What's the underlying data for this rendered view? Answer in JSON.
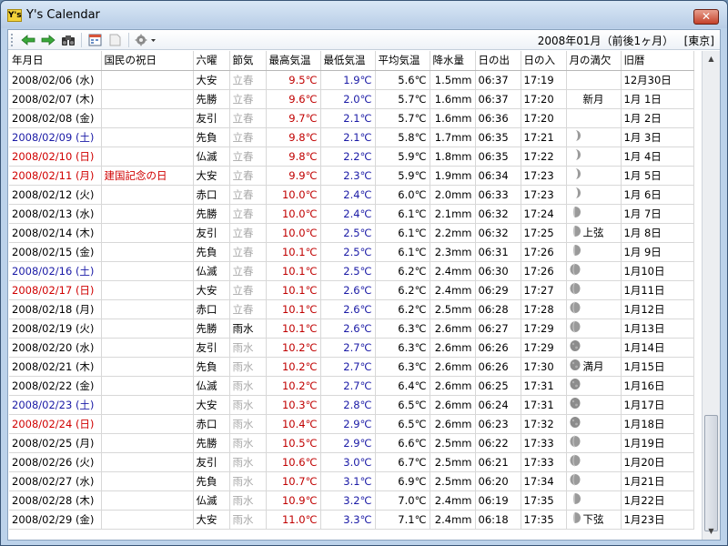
{
  "window": {
    "title": "Y's Calendar",
    "app_icon": "Y's",
    "close": "✕"
  },
  "toolbar": {
    "range_label": "2008年01月（前後1ヶ月）",
    "location": "[東京]",
    "icons": [
      "back-arrow-icon",
      "forward-arrow-icon",
      "binoculars-icon",
      "calendar-icon",
      "note-icon",
      "gear-icon"
    ]
  },
  "columns": [
    "年月日",
    "国民の祝日",
    "六曜",
    "節気",
    "最高気温",
    "最低気温",
    "平均気温",
    "降水量",
    "日の出",
    "日の入",
    "月の満欠",
    "旧暦"
  ],
  "rows": [
    {
      "date": "2008/02/06 (水)",
      "day": "weekday",
      "holiday": "",
      "rokuyo": "大安",
      "sekki": "立春",
      "sekki_dim": true,
      "max": "9.5℃",
      "min": "1.9℃",
      "avg": "5.6℃",
      "rain": "1.5mm",
      "rise": "06:37",
      "set": "17:19",
      "moon": "",
      "phase": "",
      "lunar": "12月30日"
    },
    {
      "date": "2008/02/07 (木)",
      "day": "weekday",
      "holiday": "",
      "rokuyo": "先勝",
      "sekki": "立春",
      "sekki_dim": true,
      "max": "9.6℃",
      "min": "2.0℃",
      "avg": "5.7℃",
      "rain": "1.6mm",
      "rise": "06:37",
      "set": "17:20",
      "moon": "",
      "phase": "新月",
      "lunar": "1月 1日"
    },
    {
      "date": "2008/02/08 (金)",
      "day": "weekday",
      "holiday": "",
      "rokuyo": "友引",
      "sekki": "立春",
      "sekki_dim": true,
      "max": "9.7℃",
      "min": "2.1℃",
      "avg": "5.7℃",
      "rain": "1.6mm",
      "rise": "06:36",
      "set": "17:20",
      "moon": "",
      "phase": "",
      "lunar": "1月 2日"
    },
    {
      "date": "2008/02/09 (土)",
      "day": "saturday",
      "holiday": "",
      "rokuyo": "先負",
      "sekki": "立春",
      "sekki_dim": true,
      "max": "9.8℃",
      "min": "2.1℃",
      "avg": "5.8℃",
      "rain": "1.7mm",
      "rise": "06:35",
      "set": "17:21",
      "moon": "crescent",
      "phase": "",
      "lunar": "1月 3日"
    },
    {
      "date": "2008/02/10 (日)",
      "day": "sunday",
      "holiday": "",
      "rokuyo": "仏滅",
      "sekki": "立春",
      "sekki_dim": true,
      "max": "9.8℃",
      "min": "2.2℃",
      "avg": "5.9℃",
      "rain": "1.8mm",
      "rise": "06:35",
      "set": "17:22",
      "moon": "crescent",
      "phase": "",
      "lunar": "1月 4日"
    },
    {
      "date": "2008/02/11 (月)",
      "day": "holiday",
      "holiday": "建国記念の日",
      "rokuyo": "大安",
      "sekki": "立春",
      "sekki_dim": true,
      "max": "9.9℃",
      "min": "2.3℃",
      "avg": "5.9℃",
      "rain": "1.9mm",
      "rise": "06:34",
      "set": "17:23",
      "moon": "crescent",
      "phase": "",
      "lunar": "1月 5日"
    },
    {
      "date": "2008/02/12 (火)",
      "day": "weekday",
      "holiday": "",
      "rokuyo": "赤口",
      "sekki": "立春",
      "sekki_dim": true,
      "max": "10.0℃",
      "min": "2.4℃",
      "avg": "6.0℃",
      "rain": "2.0mm",
      "rise": "06:33",
      "set": "17:23",
      "moon": "crescent",
      "phase": "",
      "lunar": "1月 6日"
    },
    {
      "date": "2008/02/13 (水)",
      "day": "weekday",
      "holiday": "",
      "rokuyo": "先勝",
      "sekki": "立春",
      "sekki_dim": true,
      "max": "10.0℃",
      "min": "2.4℃",
      "avg": "6.1℃",
      "rain": "2.1mm",
      "rise": "06:32",
      "set": "17:24",
      "moon": "half",
      "phase": "",
      "lunar": "1月 7日"
    },
    {
      "date": "2008/02/14 (木)",
      "day": "weekday",
      "holiday": "",
      "rokuyo": "友引",
      "sekki": "立春",
      "sekki_dim": true,
      "max": "10.0℃",
      "min": "2.5℃",
      "avg": "6.1℃",
      "rain": "2.2mm",
      "rise": "06:32",
      "set": "17:25",
      "moon": "half",
      "phase": "上弦",
      "lunar": "1月 8日"
    },
    {
      "date": "2008/02/15 (金)",
      "day": "weekday",
      "holiday": "",
      "rokuyo": "先負",
      "sekki": "立春",
      "sekki_dim": true,
      "max": "10.1℃",
      "min": "2.5℃",
      "avg": "6.1℃",
      "rain": "2.3mm",
      "rise": "06:31",
      "set": "17:26",
      "moon": "half",
      "phase": "",
      "lunar": "1月 9日"
    },
    {
      "date": "2008/02/16 (土)",
      "day": "saturday",
      "holiday": "",
      "rokuyo": "仏滅",
      "sekki": "立春",
      "sekki_dim": true,
      "max": "10.1℃",
      "min": "2.5℃",
      "avg": "6.2℃",
      "rain": "2.4mm",
      "rise": "06:30",
      "set": "17:26",
      "moon": "gibbous",
      "phase": "",
      "lunar": "1月10日"
    },
    {
      "date": "2008/02/17 (日)",
      "day": "sunday",
      "holiday": "",
      "rokuyo": "大安",
      "sekki": "立春",
      "sekki_dim": true,
      "max": "10.1℃",
      "min": "2.6℃",
      "avg": "6.2℃",
      "rain": "2.4mm",
      "rise": "06:29",
      "set": "17:27",
      "moon": "gibbous",
      "phase": "",
      "lunar": "1月11日"
    },
    {
      "date": "2008/02/18 (月)",
      "day": "weekday",
      "holiday": "",
      "rokuyo": "赤口",
      "sekki": "立春",
      "sekki_dim": true,
      "max": "10.1℃",
      "min": "2.6℃",
      "avg": "6.2℃",
      "rain": "2.5mm",
      "rise": "06:28",
      "set": "17:28",
      "moon": "gibbous",
      "phase": "",
      "lunar": "1月12日"
    },
    {
      "date": "2008/02/19 (火)",
      "day": "weekday",
      "holiday": "",
      "rokuyo": "先勝",
      "sekki": "雨水",
      "sekki_dim": false,
      "max": "10.1℃",
      "min": "2.6℃",
      "avg": "6.3℃",
      "rain": "2.6mm",
      "rise": "06:27",
      "set": "17:29",
      "moon": "gibbous",
      "phase": "",
      "lunar": "1月13日"
    },
    {
      "date": "2008/02/20 (水)",
      "day": "weekday",
      "holiday": "",
      "rokuyo": "友引",
      "sekki": "雨水",
      "sekki_dim": true,
      "max": "10.2℃",
      "min": "2.7℃",
      "avg": "6.3℃",
      "rain": "2.6mm",
      "rise": "06:26",
      "set": "17:29",
      "moon": "full",
      "phase": "",
      "lunar": "1月14日"
    },
    {
      "date": "2008/02/21 (木)",
      "day": "weekday",
      "holiday": "",
      "rokuyo": "先負",
      "sekki": "雨水",
      "sekki_dim": true,
      "max": "10.2℃",
      "min": "2.7℃",
      "avg": "6.3℃",
      "rain": "2.6mm",
      "rise": "06:26",
      "set": "17:30",
      "moon": "full",
      "phase": "満月",
      "lunar": "1月15日"
    },
    {
      "date": "2008/02/22 (金)",
      "day": "weekday",
      "holiday": "",
      "rokuyo": "仏滅",
      "sekki": "雨水",
      "sekki_dim": true,
      "max": "10.2℃",
      "min": "2.7℃",
      "avg": "6.4℃",
      "rain": "2.6mm",
      "rise": "06:25",
      "set": "17:31",
      "moon": "full",
      "phase": "",
      "lunar": "1月16日"
    },
    {
      "date": "2008/02/23 (土)",
      "day": "saturday",
      "holiday": "",
      "rokuyo": "大安",
      "sekki": "雨水",
      "sekki_dim": true,
      "max": "10.3℃",
      "min": "2.8℃",
      "avg": "6.5℃",
      "rain": "2.6mm",
      "rise": "06:24",
      "set": "17:31",
      "moon": "full",
      "phase": "",
      "lunar": "1月17日"
    },
    {
      "date": "2008/02/24 (日)",
      "day": "sunday",
      "holiday": "",
      "rokuyo": "赤口",
      "sekki": "雨水",
      "sekki_dim": true,
      "max": "10.4℃",
      "min": "2.9℃",
      "avg": "6.5℃",
      "rain": "2.6mm",
      "rise": "06:23",
      "set": "17:32",
      "moon": "full",
      "phase": "",
      "lunar": "1月18日"
    },
    {
      "date": "2008/02/25 (月)",
      "day": "weekday",
      "holiday": "",
      "rokuyo": "先勝",
      "sekki": "雨水",
      "sekki_dim": true,
      "max": "10.5℃",
      "min": "2.9℃",
      "avg": "6.6℃",
      "rain": "2.5mm",
      "rise": "06:22",
      "set": "17:33",
      "moon": "gibbous",
      "phase": "",
      "lunar": "1月19日"
    },
    {
      "date": "2008/02/26 (火)",
      "day": "weekday",
      "holiday": "",
      "rokuyo": "友引",
      "sekki": "雨水",
      "sekki_dim": true,
      "max": "10.6℃",
      "min": "3.0℃",
      "avg": "6.7℃",
      "rain": "2.5mm",
      "rise": "06:21",
      "set": "17:33",
      "moon": "gibbous",
      "phase": "",
      "lunar": "1月20日"
    },
    {
      "date": "2008/02/27 (水)",
      "day": "weekday",
      "holiday": "",
      "rokuyo": "先負",
      "sekki": "雨水",
      "sekki_dim": true,
      "max": "10.7℃",
      "min": "3.1℃",
      "avg": "6.9℃",
      "rain": "2.5mm",
      "rise": "06:20",
      "set": "17:34",
      "moon": "gibbous",
      "phase": "",
      "lunar": "1月21日"
    },
    {
      "date": "2008/02/28 (木)",
      "day": "weekday",
      "holiday": "",
      "rokuyo": "仏滅",
      "sekki": "雨水",
      "sekki_dim": true,
      "max": "10.9℃",
      "min": "3.2℃",
      "avg": "7.0℃",
      "rain": "2.4mm",
      "rise": "06:19",
      "set": "17:35",
      "moon": "half",
      "phase": "",
      "lunar": "1月22日"
    },
    {
      "date": "2008/02/29 (金)",
      "day": "weekday",
      "holiday": "",
      "rokuyo": "大安",
      "sekki": "雨水",
      "sekki_dim": true,
      "max": "11.0℃",
      "min": "3.3℃",
      "avg": "7.1℃",
      "rain": "2.4mm",
      "rise": "06:18",
      "set": "17:35",
      "moon": "half",
      "phase": "下弦",
      "lunar": "1月23日"
    }
  ],
  "colors": {
    "max_temp": "#c00000",
    "min_temp": "#1a1aa6",
    "saturday": "#1a1aa6",
    "sunday_holiday": "#d00000",
    "dim_sekki": "#a9a9a9"
  }
}
